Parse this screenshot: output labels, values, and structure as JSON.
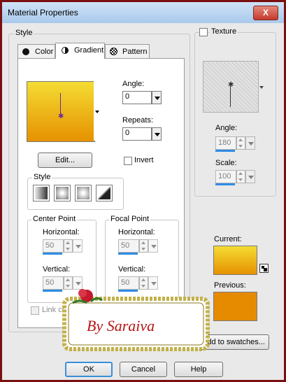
{
  "window": {
    "title": "Material Properties",
    "close_label": "X"
  },
  "style_group": {
    "label": "Style",
    "tabs": [
      {
        "label": "Color",
        "icon": "filled-circle-icon"
      },
      {
        "label": "Gradient",
        "icon": "half-circle-icon"
      },
      {
        "label": "Pattern",
        "icon": "pattern-grid-icon"
      }
    ],
    "selected_tab": "Gradient"
  },
  "gradient": {
    "colors": {
      "top": "#f4dc33",
      "bottom": "#e69100"
    },
    "angle_label": "Angle:",
    "angle_value": "0",
    "repeats_label": "Repeats:",
    "repeats_value": "0",
    "edit_label": "Edit...",
    "invert_label": "Invert",
    "style_label": "Style",
    "center_point": {
      "label": "Center Point",
      "horizontal_label": "Horizontal:",
      "horizontal_value": "50",
      "horizontal_fill": 0.5,
      "vertical_label": "Vertical:",
      "vertical_value": "50",
      "vertical_fill": 0.5
    },
    "focal_point": {
      "label": "Focal Point",
      "horizontal_label": "Horizontal:",
      "horizontal_value": "50",
      "horizontal_fill": 0.5,
      "vertical_label": "Vertical:",
      "vertical_value": "50",
      "vertical_fill": 0.5
    },
    "link_label": "Link center and focal points"
  },
  "texture": {
    "label": "Texture",
    "angle_label": "Angle:",
    "angle_value": "180",
    "angle_fill": 0.5,
    "scale_label": "Scale:",
    "scale_value": "100",
    "scale_fill": 0.5
  },
  "swatches": {
    "current_label": "Current:",
    "previous_label": "Previous:",
    "previous_color": "#e68a00",
    "add_label": "Add to swatches..."
  },
  "buttons": {
    "ok": "OK",
    "cancel": "Cancel",
    "help": "Help"
  },
  "signature": {
    "text": "By   Saraiva"
  }
}
